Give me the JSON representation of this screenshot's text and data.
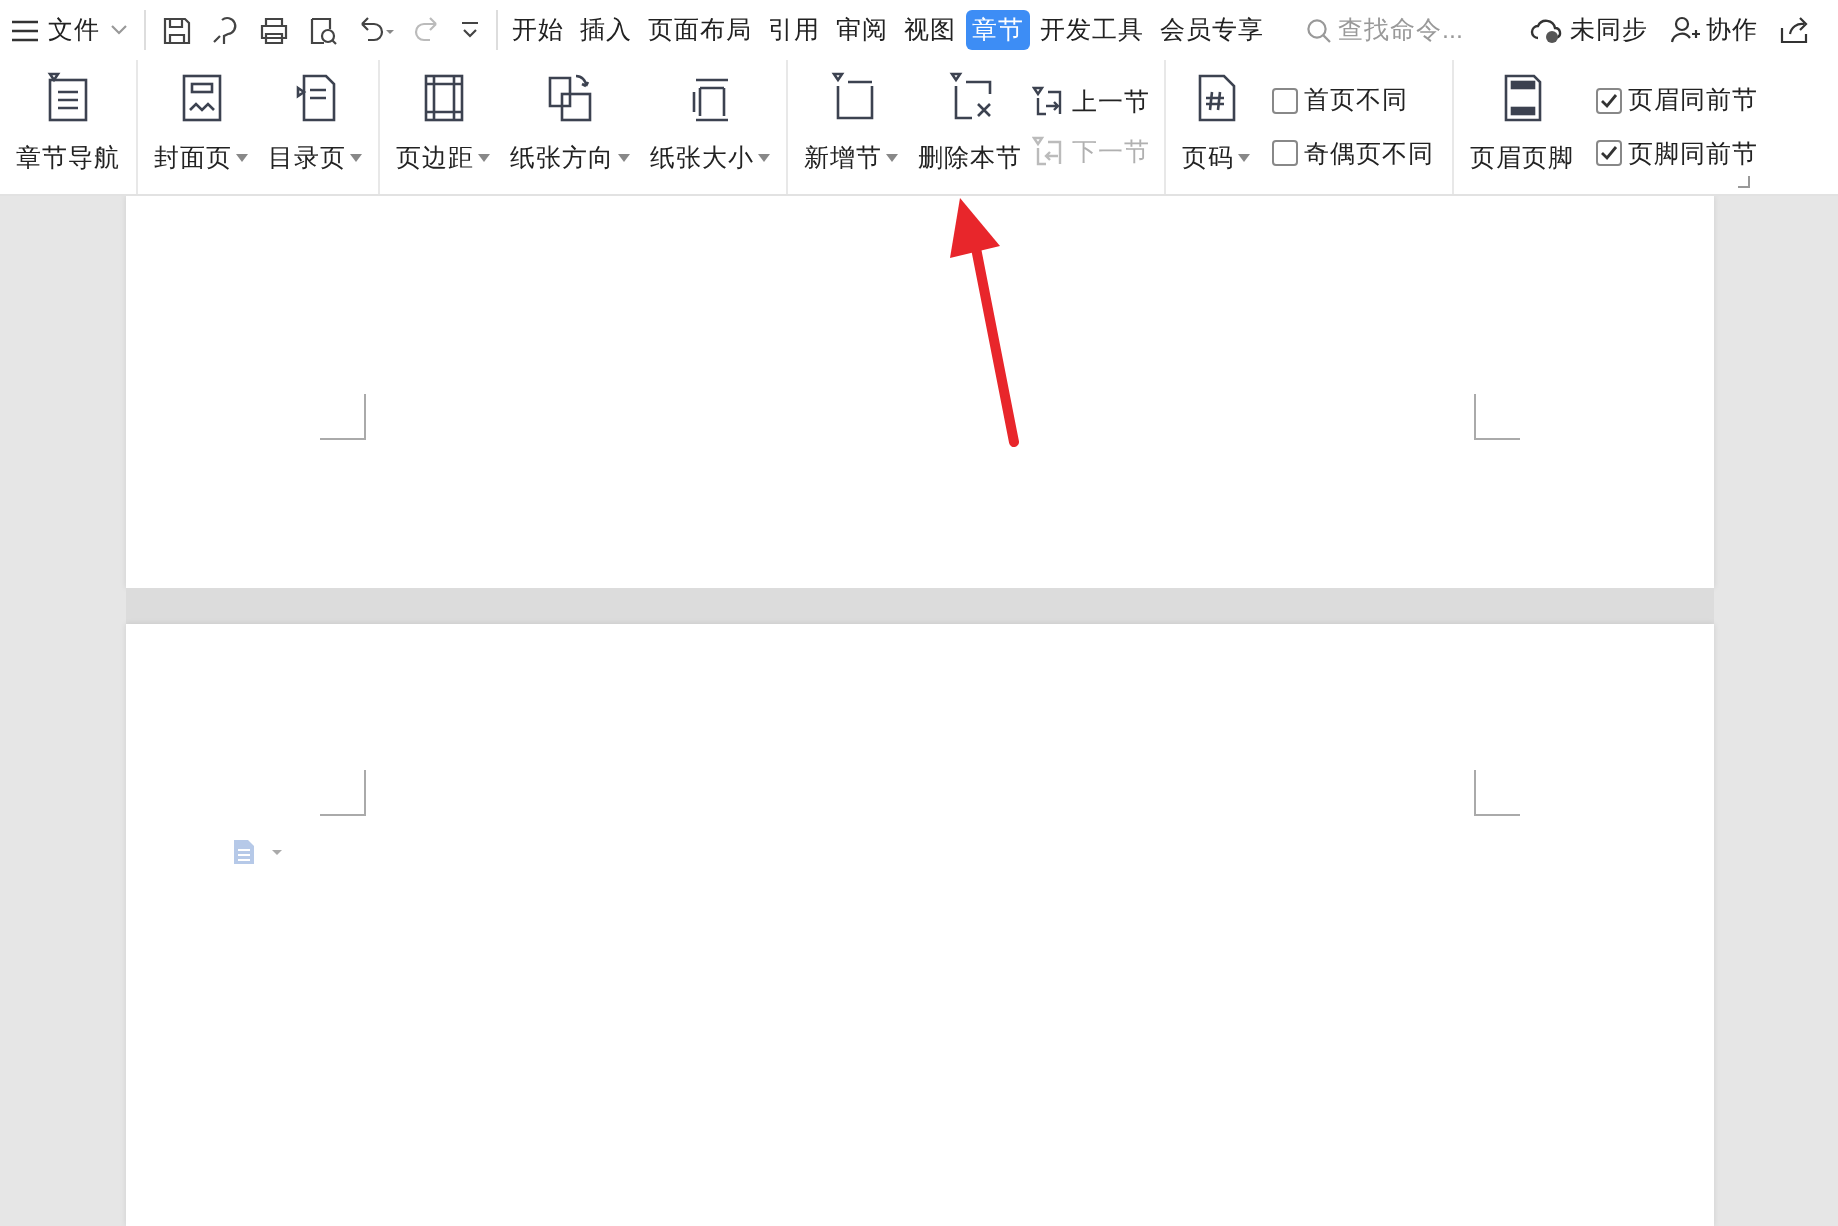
{
  "menu": {
    "label": "文件"
  },
  "tabs": [
    {
      "label": "开始",
      "selected": false
    },
    {
      "label": "插入",
      "selected": false
    },
    {
      "label": "页面布局",
      "selected": false
    },
    {
      "label": "引用",
      "selected": false
    },
    {
      "label": "审阅",
      "selected": false
    },
    {
      "label": "视图",
      "selected": false
    },
    {
      "label": "章节",
      "selected": true
    },
    {
      "label": "开发工具",
      "selected": false
    },
    {
      "label": "会员专享",
      "selected": false
    }
  ],
  "search": {
    "placeholder": "查找命令..."
  },
  "sync": {
    "label": "未同步"
  },
  "collab": {
    "label": "协作"
  },
  "ribbon": [
    [
      {
        "kind": "large",
        "label": "章节导航",
        "dropdown": false
      }
    ],
    [
      {
        "kind": "large",
        "label": "封面页",
        "dropdown": true
      },
      {
        "kind": "large",
        "label": "目录页",
        "dropdown": true
      }
    ],
    [
      {
        "kind": "large",
        "label": "页边距",
        "dropdown": true
      },
      {
        "kind": "large",
        "label": "纸张方向",
        "dropdown": true
      },
      {
        "kind": "large",
        "label": "纸张大小",
        "dropdown": true
      }
    ],
    [
      {
        "kind": "large",
        "label": "新增节",
        "dropdown": true
      },
      {
        "kind": "large",
        "label": "删除本节",
        "dropdown": false
      },
      {
        "kind": "stack",
        "items": [
          {
            "label": "上一节",
            "disabled": false
          },
          {
            "label": "下一节",
            "disabled": true
          }
        ]
      }
    ],
    [
      {
        "kind": "large",
        "label": "页码",
        "dropdown": true
      },
      {
        "kind": "checks",
        "items": [
          {
            "label": "首页不同",
            "checked": false
          },
          {
            "label": "奇偶页不同",
            "checked": false
          }
        ]
      }
    ],
    [
      {
        "kind": "large",
        "label": "页眉页脚",
        "dropdown": false
      },
      {
        "kind": "checks",
        "items": [
          {
            "label": "页眉同前节",
            "checked": true
          },
          {
            "label": "页脚同前节",
            "checked": true
          }
        ]
      }
    ]
  ]
}
